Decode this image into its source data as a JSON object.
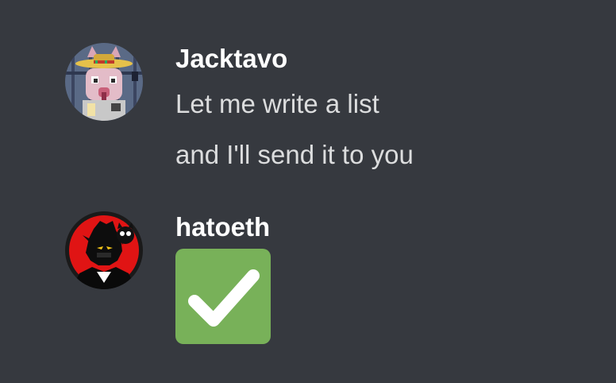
{
  "messages": [
    {
      "author": "Jacktavo",
      "avatar_icon": "sombrero-cat-avatar-icon",
      "lines": [
        "Let me write a list",
        "and I'll send it to you"
      ]
    },
    {
      "author": "hatoeth",
      "avatar_icon": "dark-character-avatar-icon",
      "emoji_icon": "white-check-mark-icon"
    }
  ],
  "colors": {
    "background": "#36393f",
    "username": "#ffffff",
    "message_text": "#dcddde",
    "check_emoji_bg": "#78b159"
  }
}
